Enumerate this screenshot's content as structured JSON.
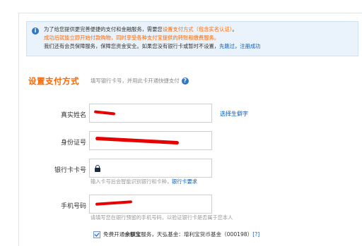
{
  "notice": {
    "line1_a": "为了给您提供更完善便捷的支付和金融服务，需要您",
    "line1_link": "设置支付方式（包含实名认证）",
    "line1_b": "。",
    "line2": "成功后就能立即开始付款购物，同时享受各种支付宝提供的转账和缴费服务。",
    "line3_a": "我们还有会员保障服务，保障您资金安全。如果您没有银行卡或暂时不设置，",
    "line3_link1": "先跳过",
    "line3_sep": "，",
    "line3_link2": "注册成功"
  },
  "section": {
    "title": "设置支付方式",
    "subtitle": "填写银行卡号，并用此卡开通快捷支付"
  },
  "fields": {
    "name_label": "真实姓名",
    "name_side_link": "选择生僻字",
    "id_label": "身份证号",
    "card_label": "银行卡卡号",
    "card_hint": "输入卡号后会智能识别银行和卡种，",
    "card_hint_link": "银行卡要求",
    "phone_label": "手机号码",
    "phone_hint": "请填写您在银行预留的手机号码，以验证银行卡是否属于您本人"
  },
  "checkbox": {
    "checked": true,
    "text_a": "免费开通",
    "text_bold": "余额宝",
    "text_b": "服务，天弘基金：增利宝货币基金（000198）",
    "help_link": "[?]"
  },
  "colors": {
    "accent_orange": "#ff6600",
    "link_blue": "#0a5bbd",
    "redaction_red": "#e60000"
  }
}
